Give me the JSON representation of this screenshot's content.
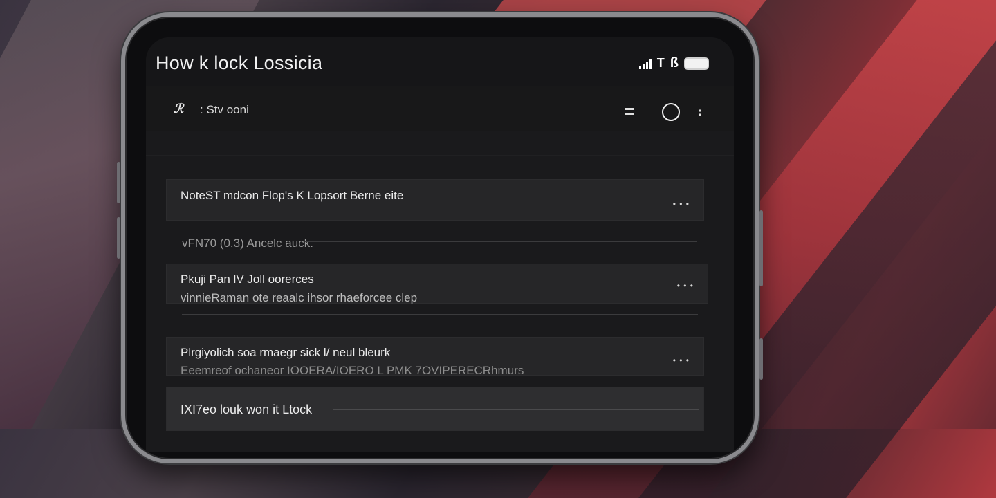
{
  "status_bar": {
    "title": "How k lock Lossicia",
    "bt_glyph": "ß"
  },
  "app_bar": {
    "back_glyph": "ℛ",
    "title": ": Stv ooni"
  },
  "list": [
    {
      "primary": "NoteST mdcon Flop's K Lopsort Berne eite",
      "secondary": "",
      "more": "• • •"
    },
    {
      "primary": "",
      "secondary": "vFN70 (0.3) Ancelc auck.",
      "more": ""
    },
    {
      "primary": "Pkuji Pan lV Joll oorerces",
      "secondary": "vinnieRaman ote reaalc ihsor rhaeforcee clep",
      "more": "• • •"
    },
    {
      "primary": "Plrgiyolich soa rmaegr sick l/ neul bleurk",
      "secondary": "Eeemreof ochaneor IOOERA/IOERO L PMK 7OVIPERECRhmurs",
      "more": "• • •"
    },
    {
      "primary": "IXI7eo louk won it Ltock",
      "secondary": "",
      "more": ""
    }
  ],
  "colors": {
    "screen_bg": "#1a1a1c",
    "card_bg": "#262628",
    "accent_red": "#c8464a"
  }
}
